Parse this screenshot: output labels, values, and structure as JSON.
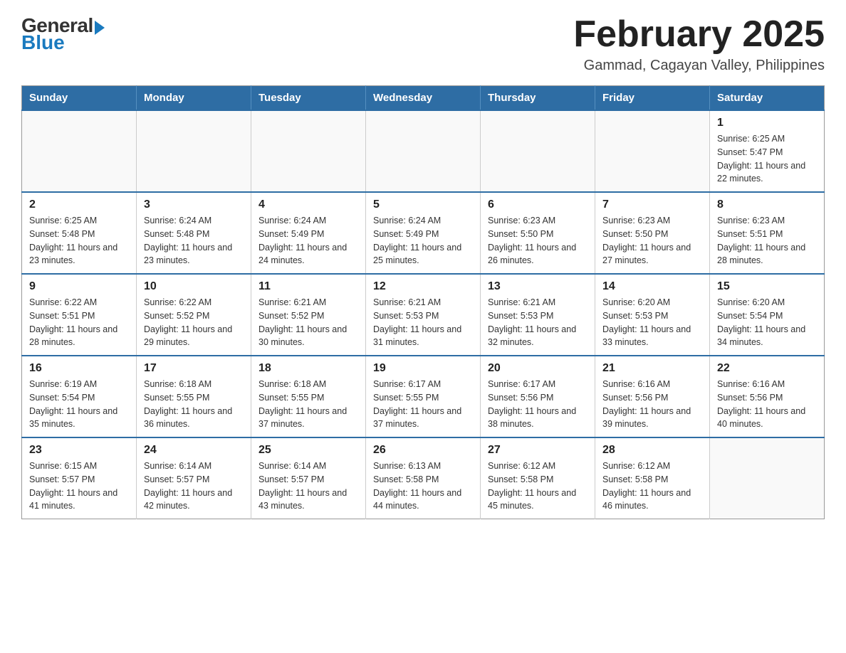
{
  "logo": {
    "general": "General",
    "blue": "Blue",
    "arrow_label": "arrow-icon"
  },
  "header": {
    "month_title": "February 2025",
    "location": "Gammad, Cagayan Valley, Philippines"
  },
  "weekdays": [
    "Sunday",
    "Monday",
    "Tuesday",
    "Wednesday",
    "Thursday",
    "Friday",
    "Saturday"
  ],
  "weeks": [
    [
      {
        "day": "",
        "sunrise": "",
        "sunset": "",
        "daylight": ""
      },
      {
        "day": "",
        "sunrise": "",
        "sunset": "",
        "daylight": ""
      },
      {
        "day": "",
        "sunrise": "",
        "sunset": "",
        "daylight": ""
      },
      {
        "day": "",
        "sunrise": "",
        "sunset": "",
        "daylight": ""
      },
      {
        "day": "",
        "sunrise": "",
        "sunset": "",
        "daylight": ""
      },
      {
        "day": "",
        "sunrise": "",
        "sunset": "",
        "daylight": ""
      },
      {
        "day": "1",
        "sunrise": "Sunrise: 6:25 AM",
        "sunset": "Sunset: 5:47 PM",
        "daylight": "Daylight: 11 hours and 22 minutes."
      }
    ],
    [
      {
        "day": "2",
        "sunrise": "Sunrise: 6:25 AM",
        "sunset": "Sunset: 5:48 PM",
        "daylight": "Daylight: 11 hours and 23 minutes."
      },
      {
        "day": "3",
        "sunrise": "Sunrise: 6:24 AM",
        "sunset": "Sunset: 5:48 PM",
        "daylight": "Daylight: 11 hours and 23 minutes."
      },
      {
        "day": "4",
        "sunrise": "Sunrise: 6:24 AM",
        "sunset": "Sunset: 5:49 PM",
        "daylight": "Daylight: 11 hours and 24 minutes."
      },
      {
        "day": "5",
        "sunrise": "Sunrise: 6:24 AM",
        "sunset": "Sunset: 5:49 PM",
        "daylight": "Daylight: 11 hours and 25 minutes."
      },
      {
        "day": "6",
        "sunrise": "Sunrise: 6:23 AM",
        "sunset": "Sunset: 5:50 PM",
        "daylight": "Daylight: 11 hours and 26 minutes."
      },
      {
        "day": "7",
        "sunrise": "Sunrise: 6:23 AM",
        "sunset": "Sunset: 5:50 PM",
        "daylight": "Daylight: 11 hours and 27 minutes."
      },
      {
        "day": "8",
        "sunrise": "Sunrise: 6:23 AM",
        "sunset": "Sunset: 5:51 PM",
        "daylight": "Daylight: 11 hours and 28 minutes."
      }
    ],
    [
      {
        "day": "9",
        "sunrise": "Sunrise: 6:22 AM",
        "sunset": "Sunset: 5:51 PM",
        "daylight": "Daylight: 11 hours and 28 minutes."
      },
      {
        "day": "10",
        "sunrise": "Sunrise: 6:22 AM",
        "sunset": "Sunset: 5:52 PM",
        "daylight": "Daylight: 11 hours and 29 minutes."
      },
      {
        "day": "11",
        "sunrise": "Sunrise: 6:21 AM",
        "sunset": "Sunset: 5:52 PM",
        "daylight": "Daylight: 11 hours and 30 minutes."
      },
      {
        "day": "12",
        "sunrise": "Sunrise: 6:21 AM",
        "sunset": "Sunset: 5:53 PM",
        "daylight": "Daylight: 11 hours and 31 minutes."
      },
      {
        "day": "13",
        "sunrise": "Sunrise: 6:21 AM",
        "sunset": "Sunset: 5:53 PM",
        "daylight": "Daylight: 11 hours and 32 minutes."
      },
      {
        "day": "14",
        "sunrise": "Sunrise: 6:20 AM",
        "sunset": "Sunset: 5:53 PM",
        "daylight": "Daylight: 11 hours and 33 minutes."
      },
      {
        "day": "15",
        "sunrise": "Sunrise: 6:20 AM",
        "sunset": "Sunset: 5:54 PM",
        "daylight": "Daylight: 11 hours and 34 minutes."
      }
    ],
    [
      {
        "day": "16",
        "sunrise": "Sunrise: 6:19 AM",
        "sunset": "Sunset: 5:54 PM",
        "daylight": "Daylight: 11 hours and 35 minutes."
      },
      {
        "day": "17",
        "sunrise": "Sunrise: 6:18 AM",
        "sunset": "Sunset: 5:55 PM",
        "daylight": "Daylight: 11 hours and 36 minutes."
      },
      {
        "day": "18",
        "sunrise": "Sunrise: 6:18 AM",
        "sunset": "Sunset: 5:55 PM",
        "daylight": "Daylight: 11 hours and 37 minutes."
      },
      {
        "day": "19",
        "sunrise": "Sunrise: 6:17 AM",
        "sunset": "Sunset: 5:55 PM",
        "daylight": "Daylight: 11 hours and 37 minutes."
      },
      {
        "day": "20",
        "sunrise": "Sunrise: 6:17 AM",
        "sunset": "Sunset: 5:56 PM",
        "daylight": "Daylight: 11 hours and 38 minutes."
      },
      {
        "day": "21",
        "sunrise": "Sunrise: 6:16 AM",
        "sunset": "Sunset: 5:56 PM",
        "daylight": "Daylight: 11 hours and 39 minutes."
      },
      {
        "day": "22",
        "sunrise": "Sunrise: 6:16 AM",
        "sunset": "Sunset: 5:56 PM",
        "daylight": "Daylight: 11 hours and 40 minutes."
      }
    ],
    [
      {
        "day": "23",
        "sunrise": "Sunrise: 6:15 AM",
        "sunset": "Sunset: 5:57 PM",
        "daylight": "Daylight: 11 hours and 41 minutes."
      },
      {
        "day": "24",
        "sunrise": "Sunrise: 6:14 AM",
        "sunset": "Sunset: 5:57 PM",
        "daylight": "Daylight: 11 hours and 42 minutes."
      },
      {
        "day": "25",
        "sunrise": "Sunrise: 6:14 AM",
        "sunset": "Sunset: 5:57 PM",
        "daylight": "Daylight: 11 hours and 43 minutes."
      },
      {
        "day": "26",
        "sunrise": "Sunrise: 6:13 AM",
        "sunset": "Sunset: 5:58 PM",
        "daylight": "Daylight: 11 hours and 44 minutes."
      },
      {
        "day": "27",
        "sunrise": "Sunrise: 6:12 AM",
        "sunset": "Sunset: 5:58 PM",
        "daylight": "Daylight: 11 hours and 45 minutes."
      },
      {
        "day": "28",
        "sunrise": "Sunrise: 6:12 AM",
        "sunset": "Sunset: 5:58 PM",
        "daylight": "Daylight: 11 hours and 46 minutes."
      },
      {
        "day": "",
        "sunrise": "",
        "sunset": "",
        "daylight": ""
      }
    ]
  ]
}
